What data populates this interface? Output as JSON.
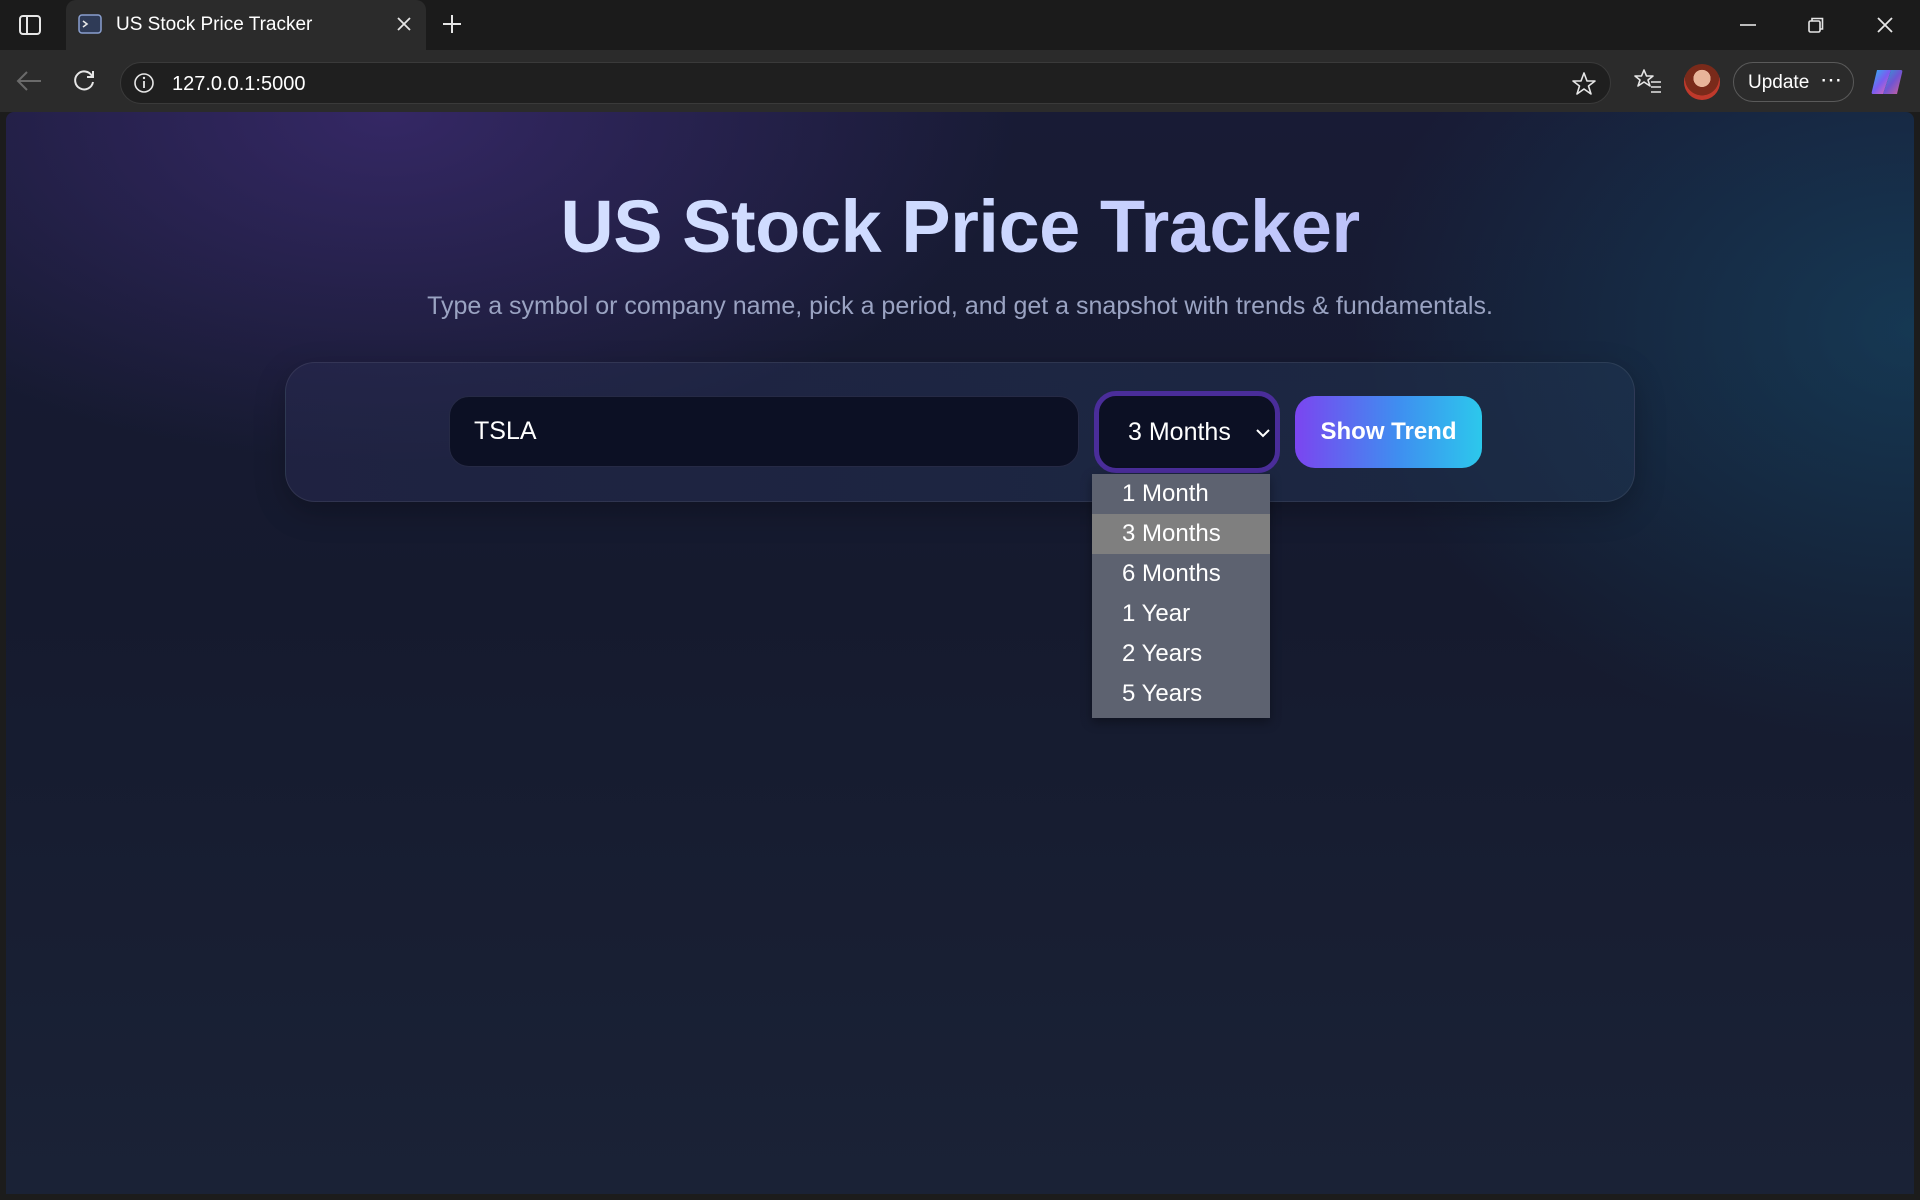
{
  "browser": {
    "tab_title": "US Stock Price Tracker",
    "url": "127.0.0.1:5000",
    "update_label": "Update",
    "more_label": "⋯"
  },
  "page": {
    "title": "US Stock Price Tracker",
    "subtitle": "Type a symbol or company name, pick a period, and get a snapshot with trends & fundamentals."
  },
  "form": {
    "symbol_value": "TSLA",
    "period_selected": "3 Months",
    "submit_label": "Show Trend",
    "period_options": [
      "1 Month",
      "3 Months",
      "6 Months",
      "1 Year",
      "2 Years",
      "5 Years"
    ],
    "selected_index": 1
  },
  "colors": {
    "accent_start": "#7b45f0",
    "accent_end": "#2cc8ec",
    "focus_border": "#4a2d9a"
  }
}
